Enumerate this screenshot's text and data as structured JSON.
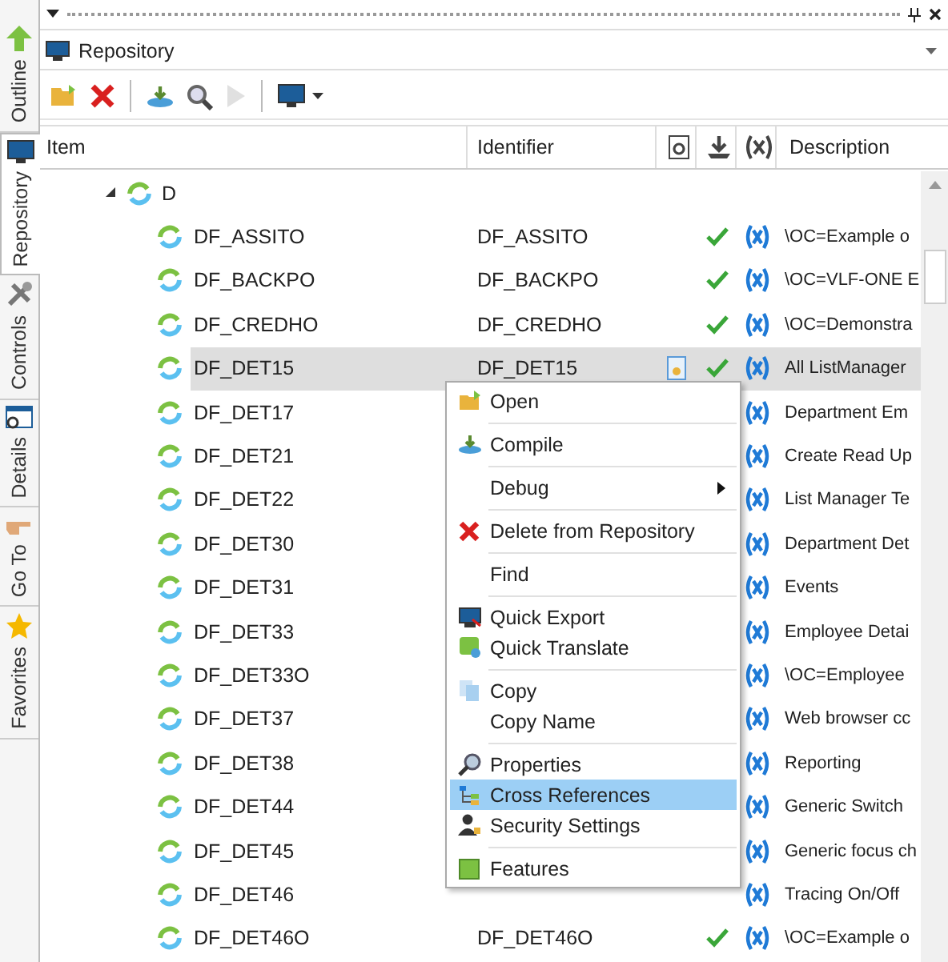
{
  "sidebar_tabs": [
    {
      "label": "Outline",
      "kind": "outline",
      "selected": false
    },
    {
      "label": "Repository",
      "kind": "repository",
      "selected": true
    },
    {
      "label": "Controls",
      "kind": "controls",
      "selected": false
    },
    {
      "label": "Details",
      "kind": "details",
      "selected": false
    },
    {
      "label": "Go To",
      "kind": "goto",
      "selected": false
    },
    {
      "label": "Favorites",
      "kind": "favorites",
      "selected": false
    }
  ],
  "view_selector": {
    "value": "Repository"
  },
  "toolbar": [
    {
      "kind": "open",
      "disabled": false
    },
    {
      "kind": "delete",
      "disabled": false
    },
    {
      "kind": "compile",
      "disabled": false
    },
    {
      "kind": "find",
      "disabled": false
    },
    {
      "kind": "run",
      "disabled": true
    },
    {
      "kind": "export",
      "disabled": false
    }
  ],
  "table": {
    "columns": [
      "Item",
      "Identifier",
      "Description"
    ],
    "tree": {
      "label": "D",
      "expanded": true,
      "children": [
        {
          "name": "DF_ASSITO",
          "identifier": "DF_ASSITO",
          "modified": false,
          "compiled": true,
          "description": "\\OC=Example o",
          "selected": false
        },
        {
          "name": "DF_BACKPO",
          "identifier": "DF_BACKPO",
          "modified": false,
          "compiled": true,
          "description": "\\OC=VLF-ONE E",
          "selected": false
        },
        {
          "name": "DF_CREDHO",
          "identifier": "DF_CREDHO",
          "modified": false,
          "compiled": true,
          "description": "\\OC=Demonstra",
          "selected": false
        },
        {
          "name": "DF_DET15",
          "identifier": "DF_DET15",
          "modified": true,
          "compiled": true,
          "description": "All ListManager",
          "selected": true
        },
        {
          "name": "DF_DET17",
          "description": "Department Em",
          "selected": false
        },
        {
          "name": "DF_DET21",
          "description": "Create Read Up",
          "selected": false
        },
        {
          "name": "DF_DET22",
          "description": "List Manager Te",
          "selected": false
        },
        {
          "name": "DF_DET30",
          "description": "Department Det",
          "selected": false
        },
        {
          "name": "DF_DET31",
          "description": "Events",
          "selected": false
        },
        {
          "name": "DF_DET33",
          "description": "Employee Detai",
          "selected": false
        },
        {
          "name": "DF_DET33O",
          "description": "\\OC=Employee",
          "selected": false
        },
        {
          "name": "DF_DET37",
          "description": "Web browser cc",
          "selected": false
        },
        {
          "name": "DF_DET38",
          "description": "Reporting",
          "selected": false
        },
        {
          "name": "DF_DET44",
          "description": "Generic Switch",
          "selected": false
        },
        {
          "name": "DF_DET45",
          "description": "Generic focus ch",
          "selected": false
        },
        {
          "name": "DF_DET46",
          "description": "Tracing On/Off",
          "selected": false
        },
        {
          "name": "DF_DET46O",
          "identifier": "DF_DET46O",
          "modified": false,
          "compiled": true,
          "description": "\\OC=Example o",
          "selected": false
        }
      ]
    }
  },
  "context_menu": {
    "groups": [
      [
        {
          "label": "Open",
          "kind": "open",
          "selected": false
        }
      ],
      [
        {
          "label": "Compile",
          "kind": "compile",
          "selected": false
        }
      ],
      [
        {
          "label": "Debug",
          "kind": "plain",
          "submenu": true,
          "selected": false
        }
      ],
      [
        {
          "label": "Delete from Repository",
          "kind": "delete",
          "selected": false
        }
      ],
      [
        {
          "label": "Find",
          "kind": "plain",
          "selected": false
        }
      ],
      [
        {
          "label": "Quick Export",
          "kind": "export",
          "selected": false
        },
        {
          "label": "Quick Translate",
          "kind": "translate",
          "selected": false
        }
      ],
      [
        {
          "label": "Copy",
          "kind": "copy",
          "selected": false
        },
        {
          "label": "Copy Name",
          "kind": "plain",
          "selected": false
        }
      ],
      [
        {
          "label": "Properties",
          "kind": "properties",
          "selected": false
        },
        {
          "label": "Cross References",
          "kind": "xref",
          "selected": true
        },
        {
          "label": "Security Settings",
          "kind": "security",
          "selected": false
        }
      ],
      [
        {
          "label": "Features",
          "kind": "features",
          "selected": false
        }
      ]
    ]
  }
}
